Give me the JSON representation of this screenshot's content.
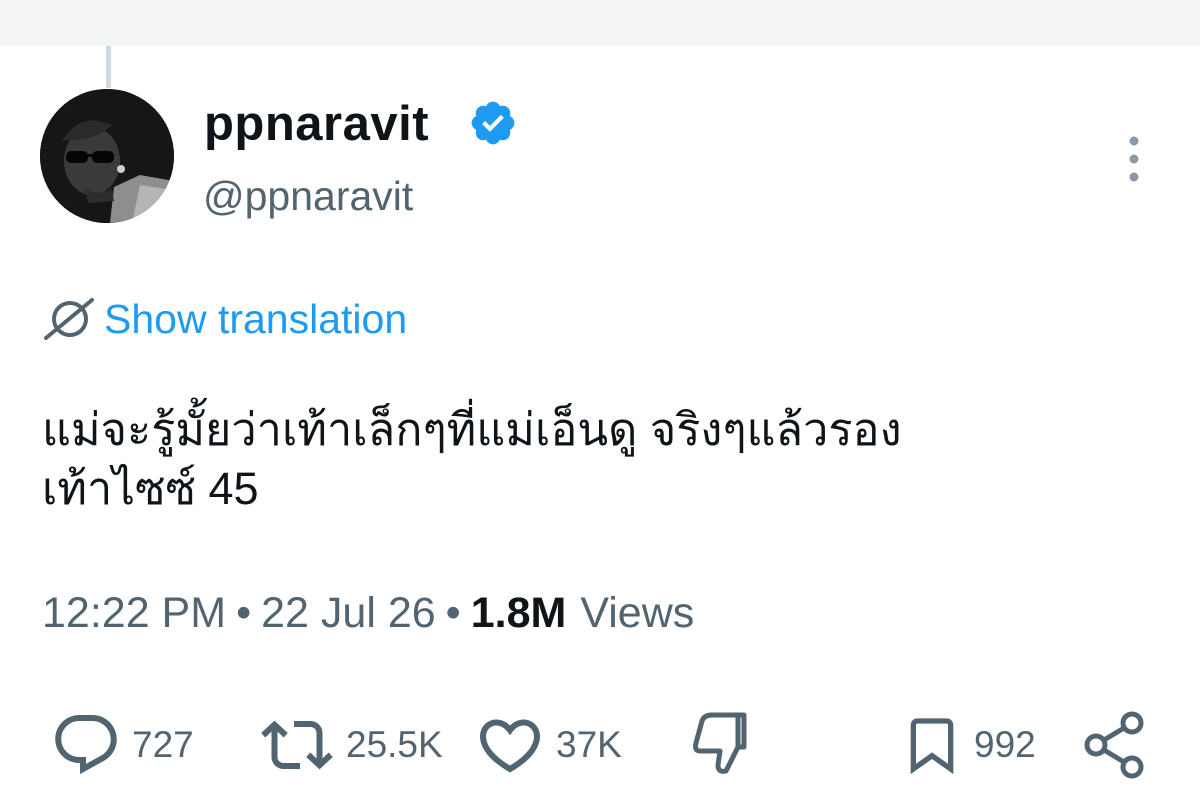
{
  "tweet": {
    "author": {
      "display_name": "ppnaravit",
      "handle": "@ppnaravit",
      "verified": true,
      "avatar_icon": "avatar-photo"
    },
    "translate_label": "Show translation",
    "text_lines": [
      "แม่จะรู้มั้ยว่าเท้าเล็กๆที่แม่เอ็นดู จริงๆแล้วรอง",
      "เท้าไซซ์ 45"
    ],
    "meta": {
      "time": "12:22 PM",
      "date": "22 Jul 26",
      "views_count": "1.8M",
      "views_label": "Views",
      "separator": "•"
    },
    "actions": {
      "reply_count": "727",
      "repost_count": "25.5K",
      "like_count": "37K",
      "bookmark_count": "992"
    }
  },
  "icons": {
    "verified": "verified-badge-icon",
    "more": "more-vertical-icon",
    "translate": "translate-globe-icon",
    "reply": "reply-icon",
    "repost": "repost-icon",
    "like": "heart-icon",
    "dislike": "dislike-icon",
    "bookmark": "bookmark-icon",
    "share": "share-icon"
  },
  "colors": {
    "accent": "#1d9bf0",
    "text_primary": "#0f1419",
    "text_secondary": "#536471"
  }
}
